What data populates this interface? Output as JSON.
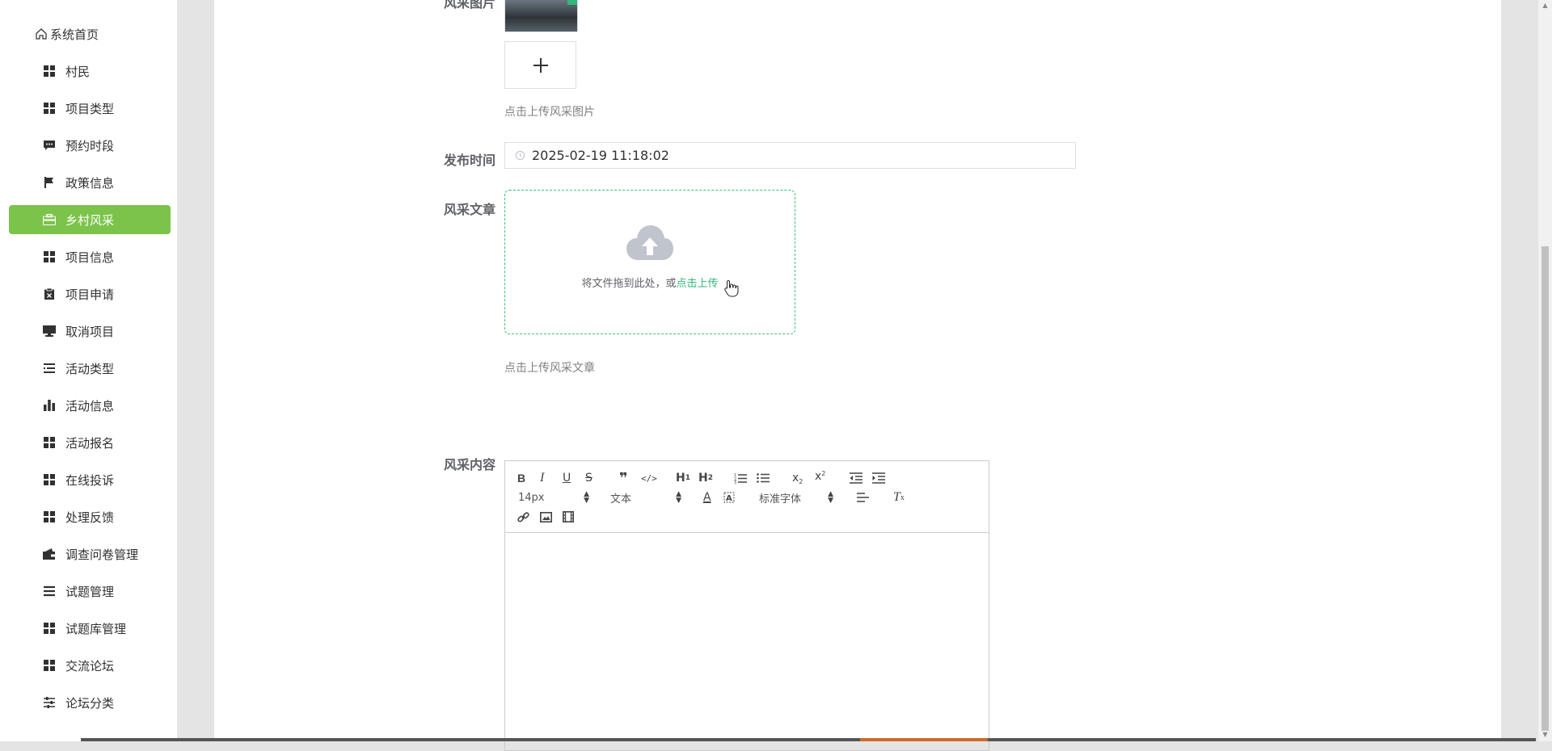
{
  "sidebar": {
    "items": [
      {
        "label": "系统首页",
        "icon": "home-icon"
      },
      {
        "label": "村民",
        "icon": "grid-icon"
      },
      {
        "label": "项目类型",
        "icon": "grid-icon"
      },
      {
        "label": "预约时段",
        "icon": "comment-icon"
      },
      {
        "label": "政策信息",
        "icon": "flag-icon"
      },
      {
        "label": "乡村风采",
        "icon": "briefcase-icon",
        "active": true
      },
      {
        "label": "项目信息",
        "icon": "grid-icon"
      },
      {
        "label": "项目申请",
        "icon": "clipboard-x-icon"
      },
      {
        "label": "取消项目",
        "icon": "monitor-icon"
      },
      {
        "label": "活动类型",
        "icon": "list-icon"
      },
      {
        "label": "活动信息",
        "icon": "bar-chart-icon"
      },
      {
        "label": "活动报名",
        "icon": "grid-icon"
      },
      {
        "label": "在线投诉",
        "icon": "grid-icon"
      },
      {
        "label": "处理反馈",
        "icon": "grid-icon"
      },
      {
        "label": "调查问卷管理",
        "icon": "wallet-icon"
      },
      {
        "label": "试题管理",
        "icon": "bars-icon"
      },
      {
        "label": "试题库管理",
        "icon": "grid-icon"
      },
      {
        "label": "交流论坛",
        "icon": "grid-icon"
      },
      {
        "label": "论坛分类",
        "icon": "sliders-icon"
      }
    ]
  },
  "form": {
    "image_label": "风采图片",
    "image_hint": "点击上传风采图片",
    "time_label": "发布时间",
    "time_value": "2025-02-19 11:18:02",
    "article_label": "风采文章",
    "dropzone_text": "将文件拖到此处，或",
    "dropzone_link": "点击上传",
    "article_hint": "点击上传风采文章",
    "content_label": "风采内容"
  },
  "editor": {
    "font_size": "14px",
    "header_select": "文本",
    "font_family": "标准字体"
  },
  "colors": {
    "accent": "#7bc34a",
    "link": "#31b77a"
  }
}
